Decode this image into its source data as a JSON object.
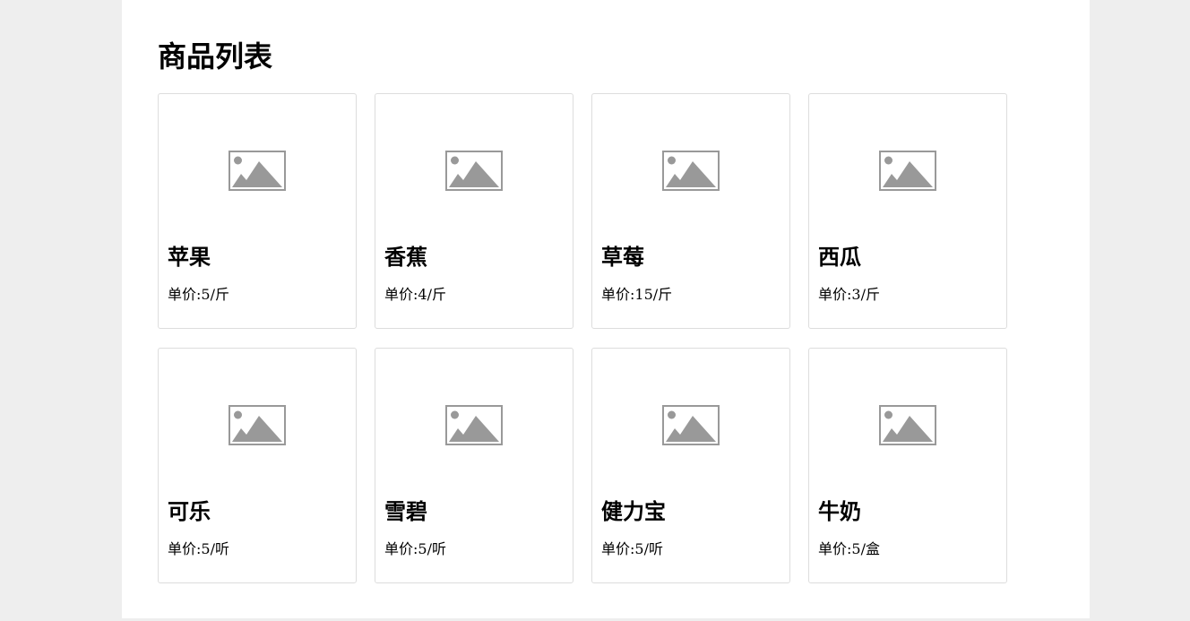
{
  "page": {
    "title": "商品列表"
  },
  "products": [
    {
      "name": "苹果",
      "price_label": "单价:",
      "price": "5/斤",
      "image_icon": "image-placeholder-icon"
    },
    {
      "name": "香蕉",
      "price_label": "单价:",
      "price": "4/斤",
      "image_icon": "image-placeholder-icon"
    },
    {
      "name": "草莓",
      "price_label": "单价:",
      "price": "15/斤",
      "image_icon": "image-placeholder-icon"
    },
    {
      "name": "西瓜",
      "price_label": "单价:",
      "price": "3/斤",
      "image_icon": "image-placeholder-icon"
    },
    {
      "name": "可乐",
      "price_label": "单价:",
      "price": "5/听",
      "image_icon": "image-placeholder-icon"
    },
    {
      "name": "雪碧",
      "price_label": "单价:",
      "price": "5/听",
      "image_icon": "image-placeholder-icon"
    },
    {
      "name": "健力宝",
      "price_label": "单价:",
      "price": "5/听",
      "image_icon": "image-placeholder-icon"
    },
    {
      "name": "牛奶",
      "price_label": "单价:",
      "price": "5/盒",
      "image_icon": "image-placeholder-icon"
    }
  ],
  "colors": {
    "page_background": "#eeeeee",
    "content_background": "#ffffff",
    "card_border": "#dddddd",
    "placeholder_gray": "#999999"
  }
}
